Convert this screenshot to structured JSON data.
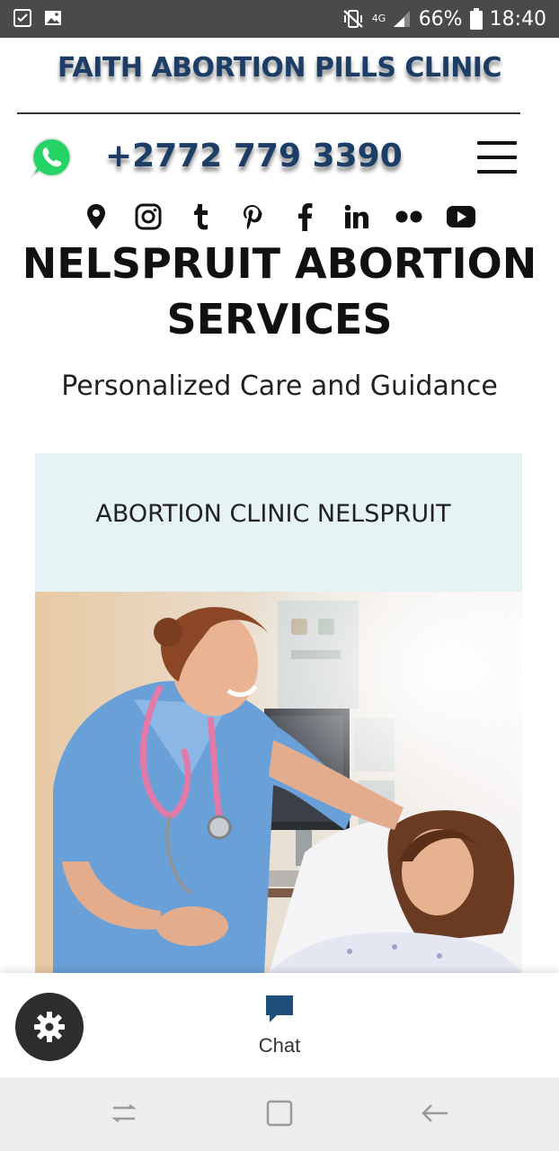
{
  "status_bar": {
    "network": "4G",
    "battery": "66%",
    "time": "18:40"
  },
  "header": {
    "clinic_title": "FAITH ABORTION PILLS CLINIC",
    "phone": "+2772 779 3390"
  },
  "social_icons": [
    "location-pin-icon",
    "instagram-icon",
    "tumblr-icon",
    "pinterest-icon",
    "facebook-icon",
    "linkedin-icon",
    "flickr-icon",
    "youtube-icon"
  ],
  "main": {
    "heading": "NELSPRUIT ABORTION SERVICES",
    "subheading": "Personalized Care and Guidance",
    "banner": "ABORTION CLINIC NELSPRUIT"
  },
  "chat": {
    "label": "Chat"
  },
  "colors": {
    "brand_navy": "#1b3d66",
    "banner_bg": "#e6f3f5",
    "chat_blue": "#1d4f7a",
    "whatsapp_green": "#25d366"
  }
}
